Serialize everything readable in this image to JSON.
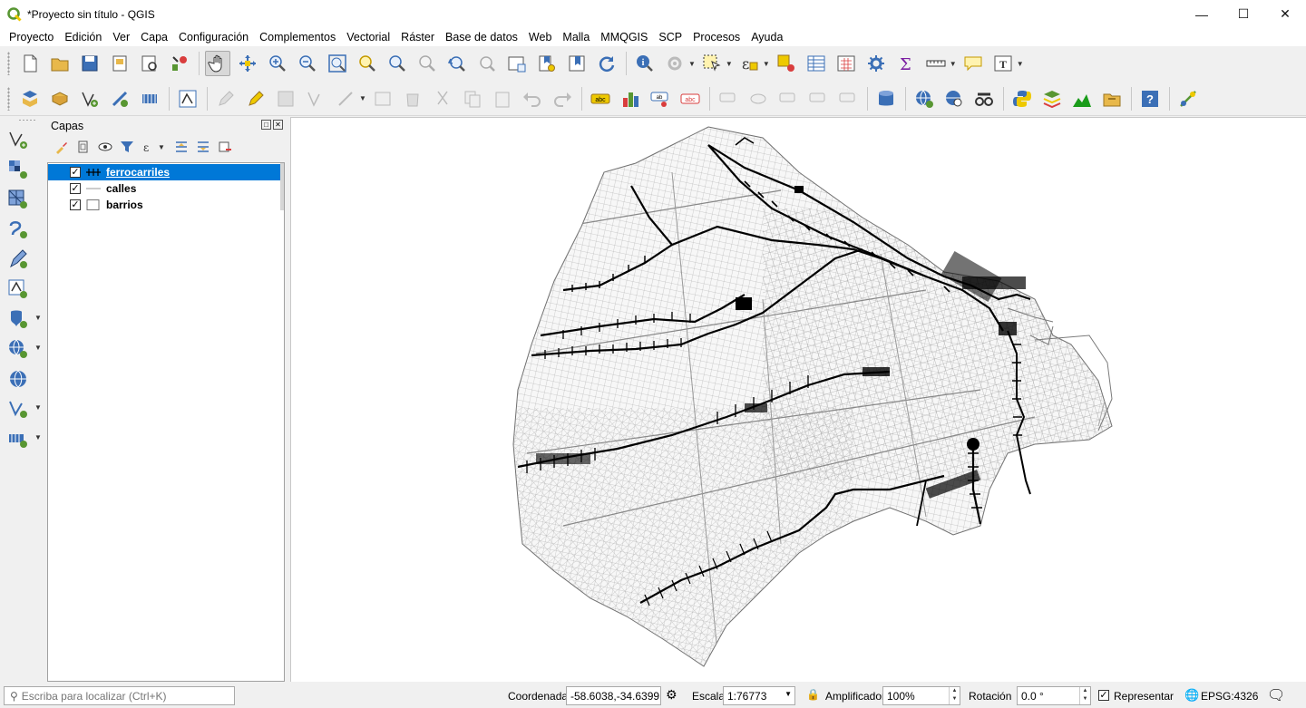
{
  "window": {
    "title": "*Proyecto sin título - QGIS"
  },
  "menu": [
    "Proyecto",
    "Edición",
    "Ver",
    "Capa",
    "Configuración",
    "Complementos",
    "Vectorial",
    "Ráster",
    "Base de datos",
    "Web",
    "Malla",
    "MMQGIS",
    "SCP",
    "Procesos",
    "Ayuda"
  ],
  "layers_panel": {
    "title": "Capas",
    "layers": [
      {
        "name": "ferrocarriles",
        "checked": "✓",
        "selected": true,
        "symbol": "railway-line"
      },
      {
        "name": "calles",
        "checked": "✓",
        "selected": false,
        "symbol": "thin-line"
      },
      {
        "name": "barrios",
        "checked": "✓",
        "selected": false,
        "symbol": "polygon-fill"
      }
    ]
  },
  "statusbar": {
    "locator_placeholder": "Escriba para localizar (Ctrl+K)",
    "coord_label": "Coordenada",
    "coord_value": "-58.6038,-34.6399",
    "scale_label": "Escala",
    "scale_value": "1:76773",
    "magnifier_label": "Amplificador",
    "magnifier_value": "100%",
    "rotation_label": "Rotación",
    "rotation_value": "0.0 °",
    "render_label": "Representar",
    "render_checked": "✓",
    "crs": "EPSG:4326"
  },
  "colors": {
    "selection": "#0078d7",
    "railway": "#000000",
    "streets": "#9a9a9a",
    "qgis_green": "#589632",
    "qgis_yellow": "#eec900"
  }
}
